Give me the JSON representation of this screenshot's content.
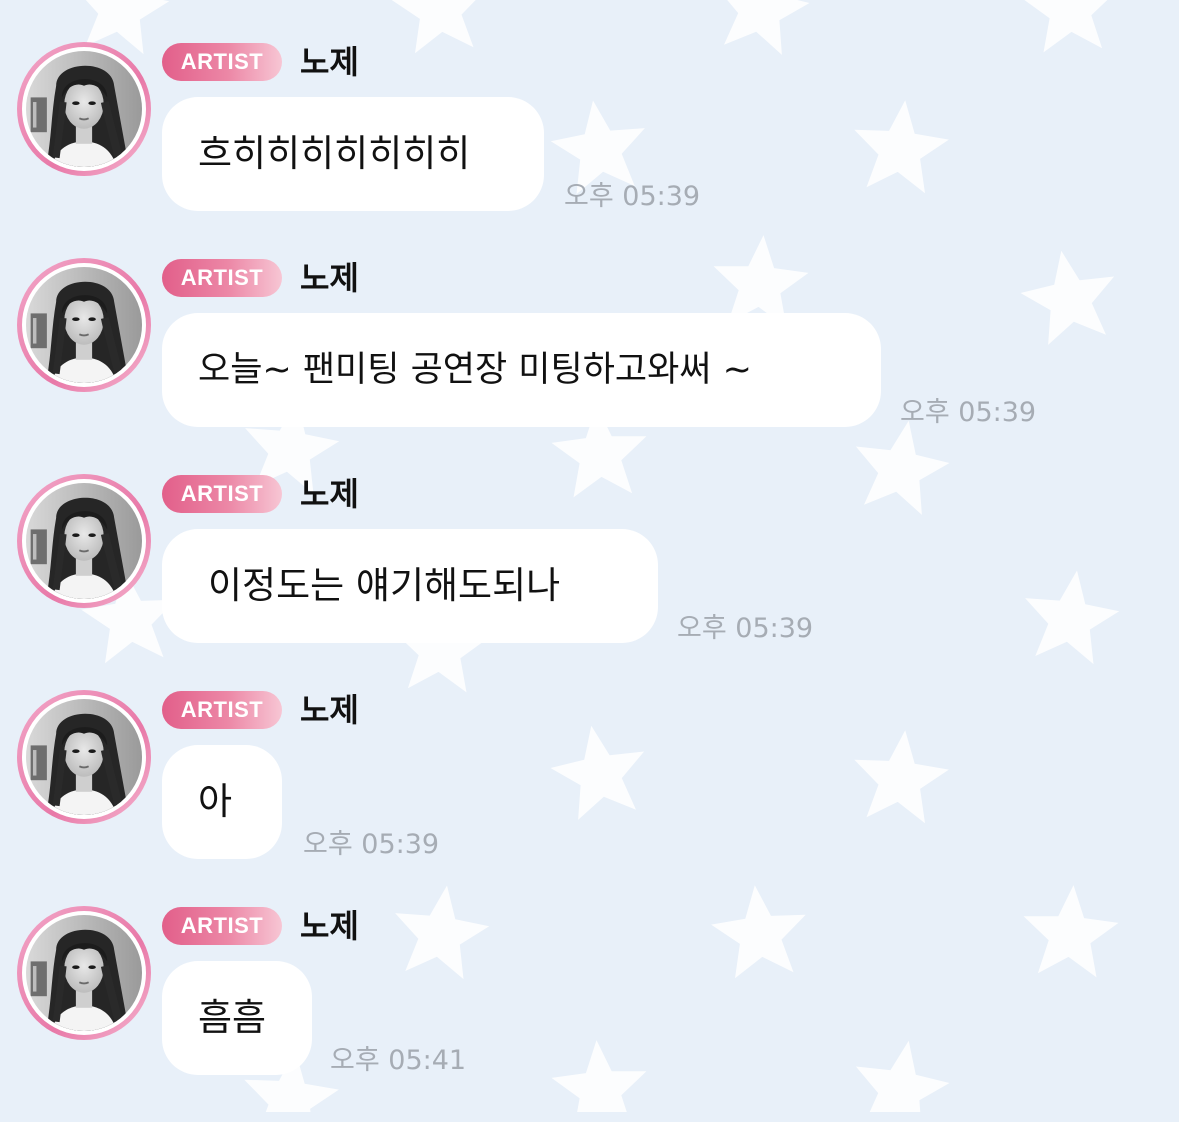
{
  "colors": {
    "background": "#e8f0f9",
    "star": "#ffffff",
    "bubble": "#ffffff",
    "badge_start": "#e25f8a",
    "badge_end": "#f7c6d4",
    "avatar_ring": "#e879a8",
    "timestamp": "#a6acb4"
  },
  "messages": [
    {
      "badge": "ARTIST",
      "sender": "노제",
      "text": "흐히히히히히히히",
      "time": "오후 05:39"
    },
    {
      "badge": "ARTIST",
      "sender": "노제",
      "text": "오늘~ 팬미팅 공연장 미팅하고와써 ~",
      "time": "오후 05:39"
    },
    {
      "badge": "ARTIST",
      "sender": "노제",
      "text": "이정도는 얘기해도되나",
      "time": "오후 05:39"
    },
    {
      "badge": "ARTIST",
      "sender": "노제",
      "text": "아",
      "time": "오후 05:39"
    },
    {
      "badge": "ARTIST",
      "sender": "노제",
      "text": "흠흠",
      "time": "오후 05:41"
    }
  ]
}
